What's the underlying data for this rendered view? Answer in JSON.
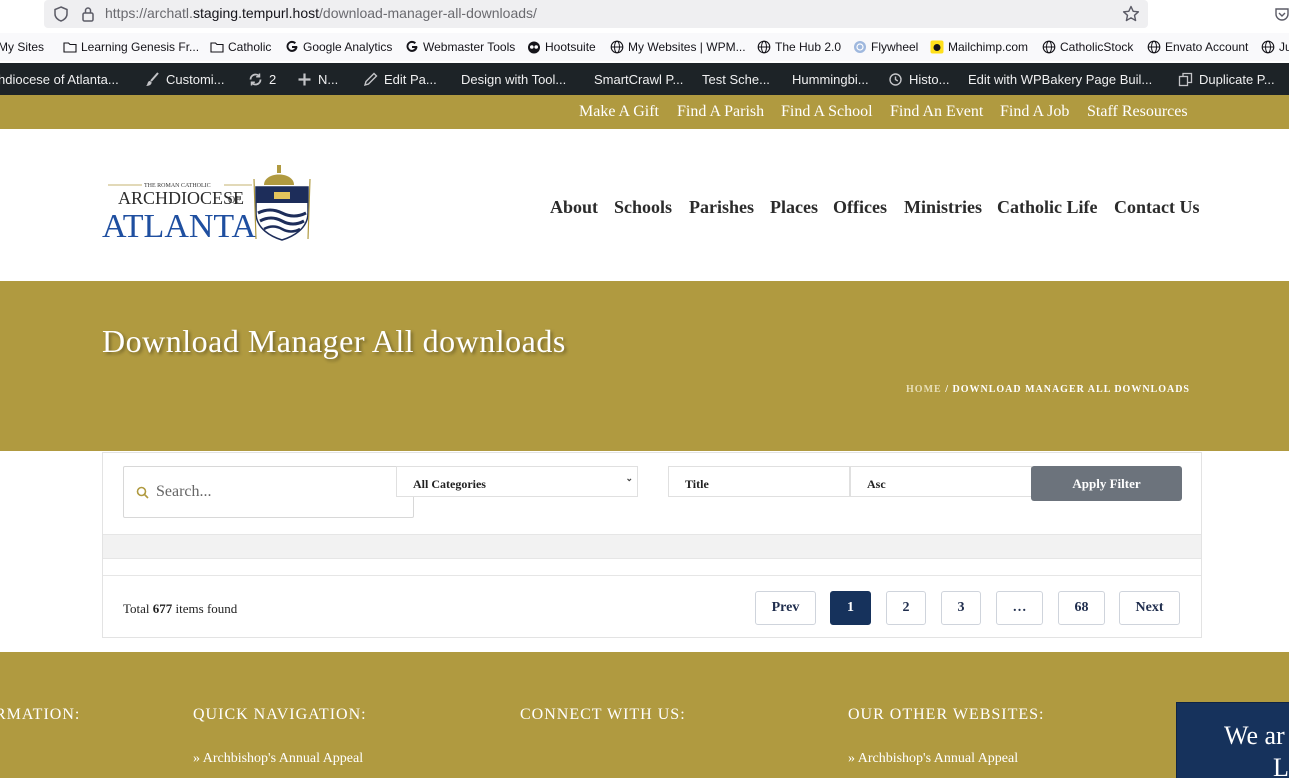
{
  "browser": {
    "url_prefix": "https://archatl.",
    "url_domain": "staging.tempurl.host",
    "url_path": "/download-manager-all-downloads/"
  },
  "bookmarks": [
    "My Sites",
    "Learning Genesis Fr...",
    "Catholic",
    "Google Analytics",
    "Webmaster Tools",
    "Hootsuite",
    "My Websites | WPM...",
    "The Hub 2.0",
    "Flywheel",
    "Mailchimp.com",
    "CatholicStock",
    "Envato Account",
    "Ju"
  ],
  "adminbar": {
    "site": "hdiocese of Atlanta...",
    "customize": "Customi...",
    "updates": "2",
    "new": "N...",
    "edit": "Edit Pa...",
    "design": "Design with Tool...",
    "smartcrawl": "SmartCrawl P...",
    "test": "Test Sche...",
    "hummingbird": "Hummingbi...",
    "history": "Histo...",
    "wpbakery": "Edit with WPBakery Page Buil...",
    "duplicate": "Duplicate P..."
  },
  "topnav": [
    "Make A Gift",
    "Find A Parish",
    "Find A School",
    "Find An Event",
    "Find A Job",
    "Staff Resources"
  ],
  "logo": {
    "line1": "THE ROMAN CATHOLIC",
    "line2": "ARCHDIOCESE",
    "line2b": "OF",
    "line3": "ATLANTA"
  },
  "mainnav": [
    "About",
    "Schools",
    "Parishes",
    "Places",
    "Offices",
    "Ministries",
    "Catholic Life",
    "Contact Us"
  ],
  "hero": {
    "title": "Download Manager All downloads",
    "breadcrumb_home": "HOME",
    "breadcrumb_sep": " / ",
    "breadcrumb_current": "DOWNLOAD MANAGER ALL DOWNLOADS"
  },
  "filters": {
    "search_placeholder": "Search...",
    "category": "All Categories",
    "orderby": "Title",
    "order": "Asc",
    "apply_label": "Apply Filter"
  },
  "results": {
    "total_prefix": "Total ",
    "total_count": "677",
    "total_suffix": " items found"
  },
  "pagination": {
    "prev": "Prev",
    "pages": [
      "1",
      "2",
      "3",
      "…",
      "68"
    ],
    "current": "1",
    "next": "Next"
  },
  "footer": {
    "col1_heading": "RMATION:",
    "col2_heading": "QUICK NAVIGATION:",
    "col3_heading": "CONNECT WITH US:",
    "col4_heading": "OUR OTHER WEBSITES:",
    "col2_link": "» Archbishop's Annual Appeal",
    "col4_link": "» Archbishop's Annual Appeal",
    "chat_line1": "We ar",
    "chat_line2": "L"
  },
  "colors": {
    "gold": "#b09a40",
    "navy": "#16325c",
    "admin": "#1d2327",
    "button_gray": "#6c737c"
  }
}
